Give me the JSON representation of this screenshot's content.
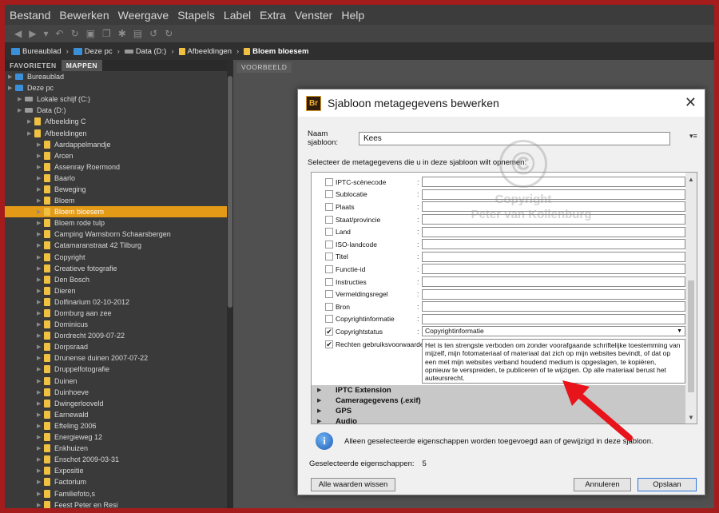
{
  "menu": [
    "Bestand",
    "Bewerken",
    "Weergave",
    "Stapels",
    "Label",
    "Extra",
    "Venster",
    "Help"
  ],
  "toolbar_icons": [
    "back-icon",
    "forward-icon",
    "dropdown-icon",
    "rotate-icon",
    "refresh-icon",
    "camera-icon",
    "copy-icon",
    "gear-icon",
    "output-icon",
    "undo-icon",
    "redo-icon"
  ],
  "path": [
    "Bureaublad",
    "Deze pc",
    "Data (D:)",
    "Afbeeldingen",
    "Bloem bloesem"
  ],
  "panel_tabs": [
    "FAVORIETEN",
    "MAPPEN"
  ],
  "preview_tab": "VOORBEELD",
  "tree": [
    {
      "label": "Bureaublad",
      "indent": 1,
      "icon": "pc"
    },
    {
      "label": "Deze pc",
      "indent": 1,
      "icon": "pc"
    },
    {
      "label": "Lokale schijf (C:)",
      "indent": 2,
      "icon": "drive"
    },
    {
      "label": "Data (D:)",
      "indent": 2,
      "icon": "drive"
    },
    {
      "label": "Afbeelding C",
      "indent": 3,
      "icon": "folder"
    },
    {
      "label": "Afbeeldingen",
      "indent": 3,
      "icon": "folder"
    },
    {
      "label": "Aardappelmandje",
      "indent": 4,
      "icon": "folder"
    },
    {
      "label": "Arcen",
      "indent": 4,
      "icon": "folder"
    },
    {
      "label": "Assenray Roermond",
      "indent": 4,
      "icon": "folder"
    },
    {
      "label": "Baarlo",
      "indent": 4,
      "icon": "folder"
    },
    {
      "label": "Beweging",
      "indent": 4,
      "icon": "folder"
    },
    {
      "label": "Bloem",
      "indent": 4,
      "icon": "folder"
    },
    {
      "label": "Bloem bloesem",
      "indent": 4,
      "icon": "folder",
      "selected": true
    },
    {
      "label": "Bloem rode tulp",
      "indent": 4,
      "icon": "folder"
    },
    {
      "label": "Camping Warnsborn Schaarsbergen",
      "indent": 4,
      "icon": "folder"
    },
    {
      "label": "Catamaranstraat 42 Tilburg",
      "indent": 4,
      "icon": "folder"
    },
    {
      "label": "Copyright",
      "indent": 4,
      "icon": "folder"
    },
    {
      "label": "Creatieve fotografie",
      "indent": 4,
      "icon": "folder"
    },
    {
      "label": "Den Bosch",
      "indent": 4,
      "icon": "folder"
    },
    {
      "label": "Dieren",
      "indent": 4,
      "icon": "folder"
    },
    {
      "label": "Dolfinarium 02-10-2012",
      "indent": 4,
      "icon": "folder"
    },
    {
      "label": "Domburg aan zee",
      "indent": 4,
      "icon": "folder"
    },
    {
      "label": "Dominicus",
      "indent": 4,
      "icon": "folder"
    },
    {
      "label": "Dordrecht 2009-07-22",
      "indent": 4,
      "icon": "folder"
    },
    {
      "label": "Dorpsraad",
      "indent": 4,
      "icon": "folder"
    },
    {
      "label": "Drunense duinen 2007-07-22",
      "indent": 4,
      "icon": "folder"
    },
    {
      "label": "Druppelfotografie",
      "indent": 4,
      "icon": "folder"
    },
    {
      "label": "Duinen",
      "indent": 4,
      "icon": "folder"
    },
    {
      "label": "Duinhoeve",
      "indent": 4,
      "icon": "folder"
    },
    {
      "label": "Dwingerlooveld",
      "indent": 4,
      "icon": "folder"
    },
    {
      "label": "Earnewald",
      "indent": 4,
      "icon": "folder"
    },
    {
      "label": "Efteling 2006",
      "indent": 4,
      "icon": "folder"
    },
    {
      "label": "Energieweg 12",
      "indent": 4,
      "icon": "folder"
    },
    {
      "label": "Enkhuizen",
      "indent": 4,
      "icon": "folder"
    },
    {
      "label": "Enschot 2009-03-31",
      "indent": 4,
      "icon": "folder"
    },
    {
      "label": "Expositie",
      "indent": 4,
      "icon": "folder"
    },
    {
      "label": "Factorium",
      "indent": 4,
      "icon": "folder"
    },
    {
      "label": "Familiefoto,s",
      "indent": 4,
      "icon": "folder"
    },
    {
      "label": "Feest Peter en Resi",
      "indent": 4,
      "icon": "folder"
    }
  ],
  "dialog": {
    "title": "Sjabloon metagegevens bewerken",
    "name_label": "Naam sjabloon:",
    "name_value": "Kees",
    "select_desc": "Selecteer de metagegevens die u in deze sjabloon wilt opnemen:",
    "fields": [
      {
        "label": "IPTC-scènecode",
        "checked": false,
        "value": ""
      },
      {
        "label": "Sublocatie",
        "checked": false,
        "value": ""
      },
      {
        "label": "Plaats",
        "checked": false,
        "value": ""
      },
      {
        "label": "Staat/provincie",
        "checked": false,
        "value": ""
      },
      {
        "label": "Land",
        "checked": false,
        "value": ""
      },
      {
        "label": "ISO-landcode",
        "checked": false,
        "value": ""
      },
      {
        "label": "Titel",
        "checked": false,
        "value": ""
      },
      {
        "label": "Functie-id",
        "checked": false,
        "value": ""
      },
      {
        "label": "Instructies",
        "checked": false,
        "value": ""
      },
      {
        "label": "Vermeldingsregel",
        "checked": false,
        "value": ""
      },
      {
        "label": "Bron",
        "checked": false,
        "value": ""
      },
      {
        "label": "Copyrightinformatie",
        "checked": false,
        "value": ""
      }
    ],
    "copyright_status": {
      "label": "Copyrightstatus",
      "checked": true,
      "value": "Copyrightinformatie"
    },
    "rights": {
      "label": "Rechten gebruiksvoorwaarden",
      "checked": true,
      "value": "Het is ten strengste verboden om zonder voorafgaande schriftelijke toestemming van mijzelf, mijn fotomateriaal of materiaal dat zich op mijn websites bevindt, of dat op een met mijn websites verband houdend medium is opgeslagen, te kopiëren, opnieuw te verspreiden, te publiceren of te wijzigen. Op alle materiaal berust het auteursrecht."
    },
    "groups": [
      "IPTC Extension",
      "Cameragegevens (.exif)",
      "GPS",
      "Audio"
    ],
    "info_text": "Alleen geselecteerde eigenschappen worden toegevoegd aan of gewijzigd in deze sjabloon.",
    "selected_label": "Geselecteerde eigenschappen:",
    "selected_count": "5",
    "btn_clear": "Alle waarden wissen",
    "btn_cancel": "Annuleren",
    "btn_save": "Opslaan"
  },
  "watermark": {
    "line1": "Copyright",
    "line2": "Peter van Kollenburg"
  },
  "colors": {
    "selection": "#e39a16",
    "arrow": "#e8141c",
    "frame": "#a51c1c"
  }
}
